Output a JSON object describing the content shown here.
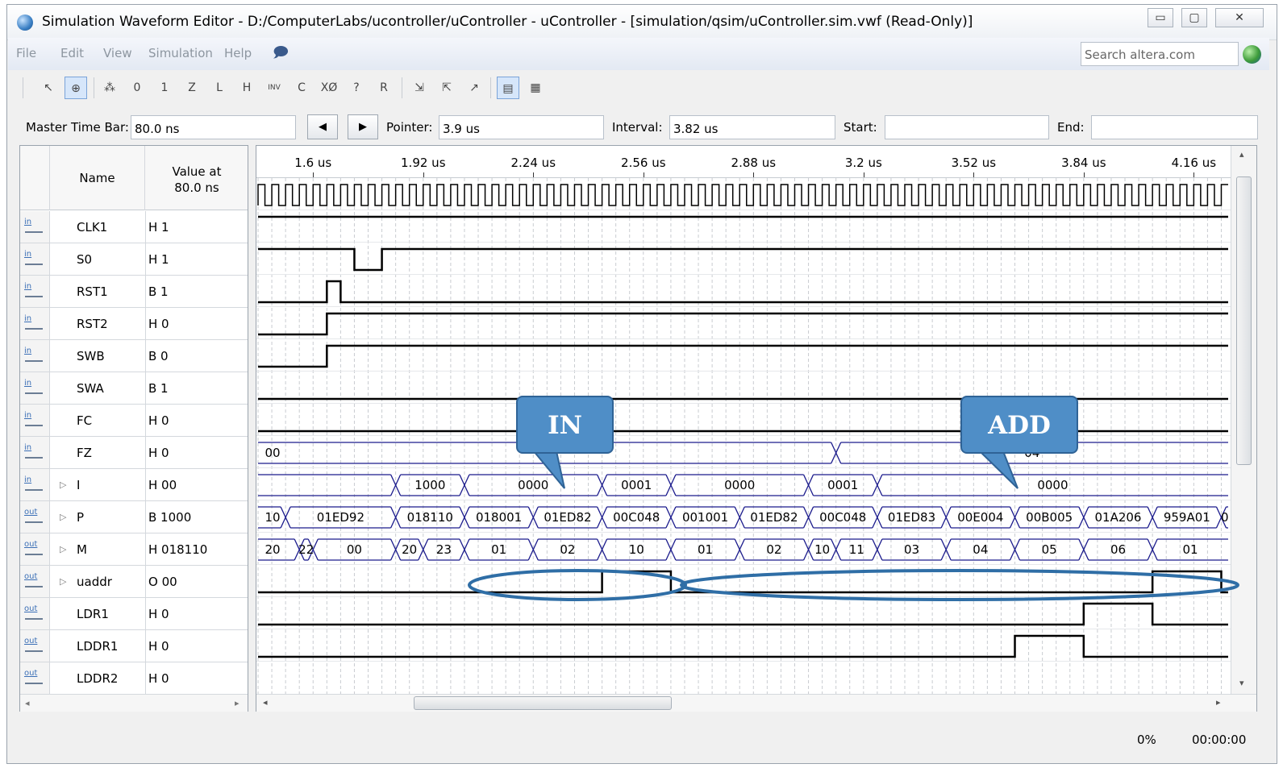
{
  "window": {
    "title": "Simulation Waveform Editor - D:/ComputerLabs/ucontroller/uController - uController - [simulation/qsim/uController.sim.vwf (Read-Only)]",
    "controls": [
      "▭",
      "▢",
      "✕"
    ]
  },
  "menu": {
    "items": [
      "File",
      "Edit",
      "View",
      "Simulation",
      "Help"
    ],
    "search_placeholder": "Search altera.com"
  },
  "toolbar": {
    "icons": [
      "pointer-tool-icon",
      "zoom-tool-icon",
      "unknown-value-icon",
      "force-low-icon",
      "force-high-icon",
      "high-impedance-icon",
      "weak-low-icon",
      "weak-high-icon",
      "invert-icon",
      "count-value-icon",
      "clock-value-icon",
      "arbitrary-value-icon",
      "random-value-icon",
      "snap-grid-icon",
      "waveform-compare-icon",
      "insert-node-icon",
      "grid-toggle-icon",
      "overwrite-mode-icon"
    ],
    "glyphs": [
      "↖",
      "⊕",
      "⁂",
      "0",
      "1",
      "Z",
      "L",
      "H",
      "INV",
      "C",
      "XØ",
      "?",
      "R",
      "⇲",
      "⇱",
      "↗",
      "▤",
      "▦"
    ]
  },
  "timebar": {
    "master_label": "Master Time Bar:",
    "master_value": "80.0 ns",
    "pointer_label": "Pointer:",
    "pointer_value": "3.9 us",
    "interval_label": "Interval:",
    "interval_value": "3.82 us",
    "start_label": "Start:",
    "start_value": "",
    "end_label": "End:",
    "end_value": ""
  },
  "name_panel": {
    "col_name": "Name",
    "col_value_line1": "Value at",
    "col_value_line2": "80.0 ns",
    "signals": [
      {
        "name": "CLK1",
        "dir": "in",
        "value": "H 1",
        "bus": false
      },
      {
        "name": "S0",
        "dir": "in",
        "value": "H 1",
        "bus": false
      },
      {
        "name": "RST1",
        "dir": "in",
        "value": "B 1",
        "bus": false
      },
      {
        "name": "RST2",
        "dir": "in",
        "value": "H 0",
        "bus": false
      },
      {
        "name": "SWB",
        "dir": "in",
        "value": "B 0",
        "bus": false
      },
      {
        "name": "SWA",
        "dir": "in",
        "value": "B 1",
        "bus": false
      },
      {
        "name": "FC",
        "dir": "in",
        "value": "H 0",
        "bus": false
      },
      {
        "name": "FZ",
        "dir": "in",
        "value": "H 0",
        "bus": false
      },
      {
        "name": "I",
        "dir": "in",
        "value": "H 00",
        "bus": true
      },
      {
        "name": "P",
        "dir": "out",
        "value": "B 1000",
        "bus": true
      },
      {
        "name": "M",
        "dir": "out",
        "value": "H 018110",
        "bus": true
      },
      {
        "name": "uaddr",
        "dir": "out",
        "value": "O 00",
        "bus": true
      },
      {
        "name": "LDR1",
        "dir": "out",
        "value": "H 0",
        "bus": false
      },
      {
        "name": "LDDR1",
        "dir": "out",
        "value": "H 0",
        "bus": false
      },
      {
        "name": "LDDR2",
        "dir": "out",
        "value": "H 0",
        "bus": false
      }
    ]
  },
  "ruler": {
    "ticks": [
      "1.6 us",
      "1.92 us",
      "2.24 us",
      "2.56 us",
      "2.88 us",
      "3.2 us",
      "3.52 us",
      "3.84 us",
      "4.16 us"
    ],
    "tick_times": [
      1.6,
      1.92,
      2.24,
      2.56,
      2.88,
      3.2,
      3.52,
      3.84,
      4.16
    ]
  },
  "waveforms": {
    "view_start_us": 1.44,
    "view_end_us": 4.26,
    "clk_period_us": 0.04,
    "S0": [
      [
        1.44,
        1
      ]
    ],
    "RST1": [
      [
        1.44,
        1
      ],
      [
        1.72,
        0
      ],
      [
        1.8,
        1
      ]
    ],
    "RST2": [
      [
        1.44,
        0
      ],
      [
        1.64,
        1
      ],
      [
        1.68,
        0
      ]
    ],
    "SWB": [
      [
        1.44,
        0
      ],
      [
        1.64,
        1
      ]
    ],
    "SWA": [
      [
        1.44,
        0
      ],
      [
        1.64,
        1
      ]
    ],
    "FC": [
      [
        1.44,
        0
      ]
    ],
    "FZ": [
      [
        1.44,
        0
      ]
    ],
    "I": [
      [
        1.44,
        "00"
      ],
      [
        3.12,
        "04"
      ]
    ],
    "P": [
      [
        1.44,
        ""
      ],
      [
        1.84,
        "1000"
      ],
      [
        2.04,
        "0000"
      ],
      [
        2.44,
        "0001"
      ],
      [
        2.64,
        "0000"
      ],
      [
        3.04,
        "0001"
      ],
      [
        3.24,
        "0000"
      ]
    ],
    "M": [
      [
        1.44,
        "10"
      ],
      [
        1.52,
        "01ED92"
      ],
      [
        1.84,
        "018110"
      ],
      [
        2.04,
        "018001"
      ],
      [
        2.24,
        "01ED82"
      ],
      [
        2.44,
        "00C048"
      ],
      [
        2.64,
        "001001"
      ],
      [
        2.84,
        "01ED82"
      ],
      [
        3.04,
        "00C048"
      ],
      [
        3.24,
        "01ED83"
      ],
      [
        3.44,
        "00E004"
      ],
      [
        3.64,
        "00B005"
      ],
      [
        3.84,
        "01A206"
      ],
      [
        4.04,
        "959A01"
      ],
      [
        4.24,
        "0"
      ]
    ],
    "uaddr": [
      [
        1.44,
        "20"
      ],
      [
        1.56,
        "22"
      ],
      [
        1.6,
        "00"
      ],
      [
        1.84,
        "20"
      ],
      [
        1.92,
        "23"
      ],
      [
        2.04,
        "01"
      ],
      [
        2.24,
        "02"
      ],
      [
        2.44,
        "10"
      ],
      [
        2.64,
        "01"
      ],
      [
        2.84,
        "02"
      ],
      [
        3.04,
        "10"
      ],
      [
        3.12,
        "11"
      ],
      [
        3.24,
        "03"
      ],
      [
        3.44,
        "04"
      ],
      [
        3.64,
        "05"
      ],
      [
        3.84,
        "06"
      ],
      [
        4.04,
        "01"
      ]
    ],
    "LDR1": [
      [
        1.44,
        0
      ],
      [
        2.44,
        1
      ],
      [
        2.64,
        0
      ],
      [
        4.04,
        1
      ],
      [
        4.24,
        0
      ]
    ],
    "LDDR1": [
      [
        1.44,
        0
      ],
      [
        3.84,
        1
      ],
      [
        4.04,
        0
      ]
    ],
    "LDDR2": [
      [
        1.44,
        0
      ],
      [
        3.64,
        1
      ],
      [
        3.84,
        0
      ]
    ]
  },
  "annotations": {
    "in_label": "IN",
    "add_label": "ADD"
  },
  "status": {
    "progress": "0%",
    "elapsed": "00:00:00"
  },
  "colors": {
    "bus": "#1a1a8c",
    "signal": "#000000",
    "callout_fill": "#4f8ec7",
    "ellipse": "#2f6ea6"
  }
}
